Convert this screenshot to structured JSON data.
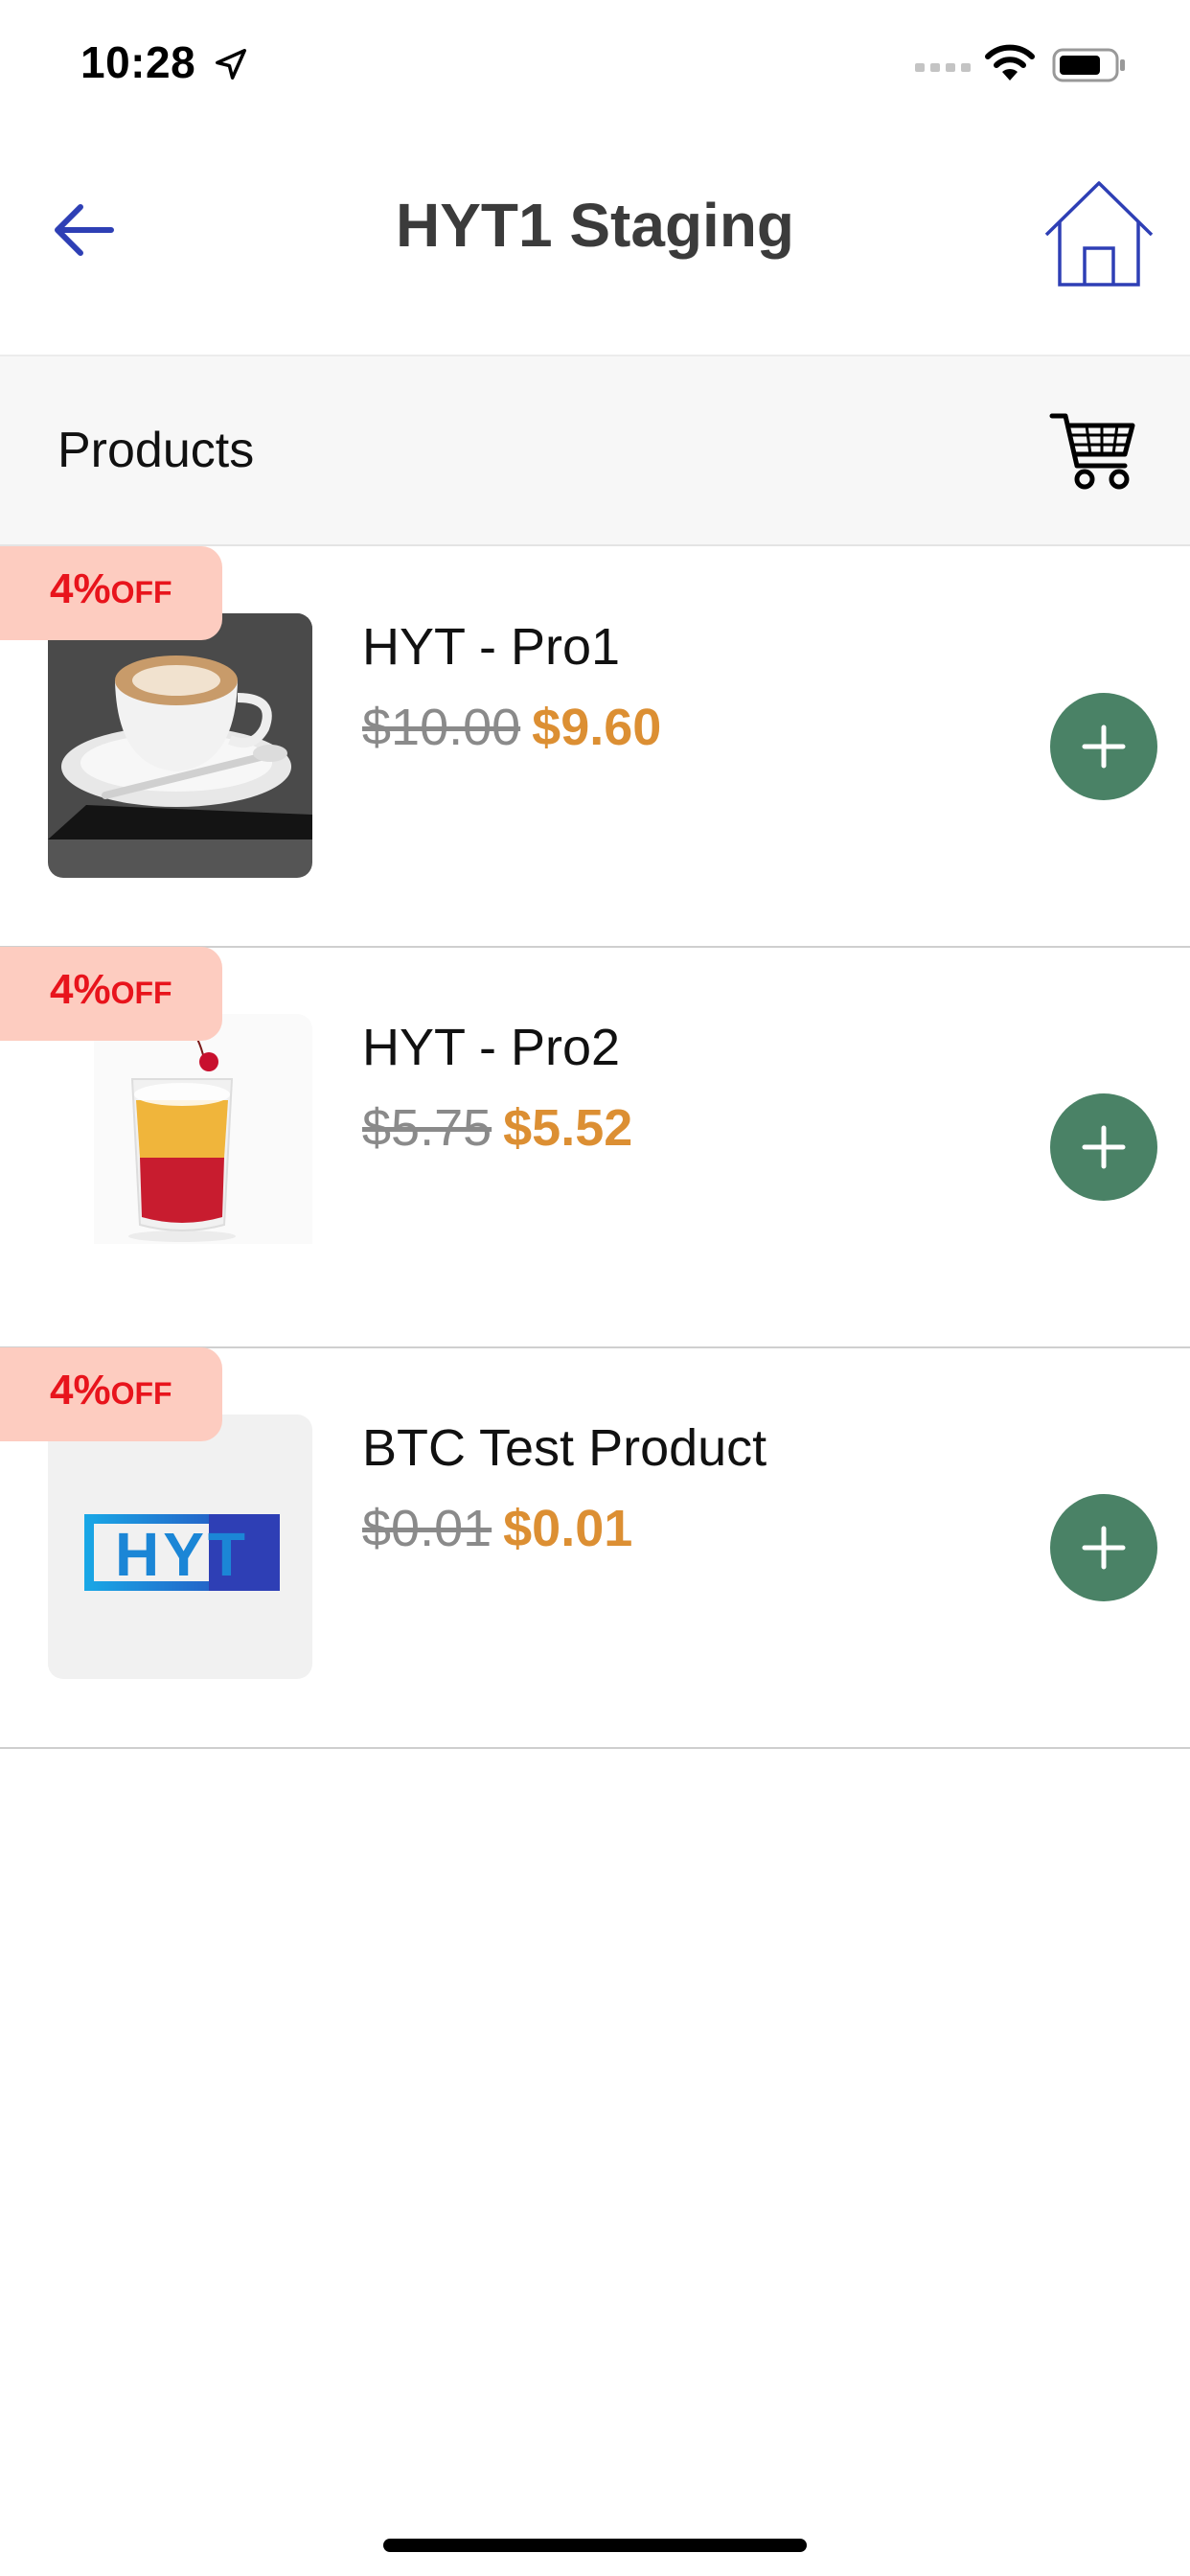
{
  "status_bar": {
    "time": "10:28",
    "icons": [
      "location-arrow-icon",
      "cellular-signal-icon",
      "wifi-icon",
      "battery-icon"
    ]
  },
  "header": {
    "title": "HYT1 Staging",
    "back_icon": "arrow-left-icon",
    "home_icon": "home-icon"
  },
  "products_bar": {
    "label": "Products",
    "cart_icon": "shopping-cart-icon"
  },
  "products": [
    {
      "name": "HYT - Pro1",
      "old_price": "$10.00",
      "new_price": "$9.60",
      "discount": "4%",
      "discount_suffix": "OFF",
      "image": "coffee-cup-image"
    },
    {
      "name": "HYT - Pro2",
      "old_price": "$5.75",
      "new_price": "$5.52",
      "discount": "4%",
      "discount_suffix": "OFF",
      "image": "iced-drink-image"
    },
    {
      "name": "BTC Test Product",
      "old_price": "$0.01",
      "new_price": "$0.01",
      "discount": "4%",
      "discount_suffix": "OFF",
      "image": "hyt-logo-image",
      "logo_text": "HYT"
    }
  ],
  "colors": {
    "accent_blue": "#2e3fb5",
    "add_button": "#4a8266",
    "sale_price": "#dc8f33",
    "discount_badge_bg": "#fdccc0",
    "discount_text": "#e8141c"
  }
}
